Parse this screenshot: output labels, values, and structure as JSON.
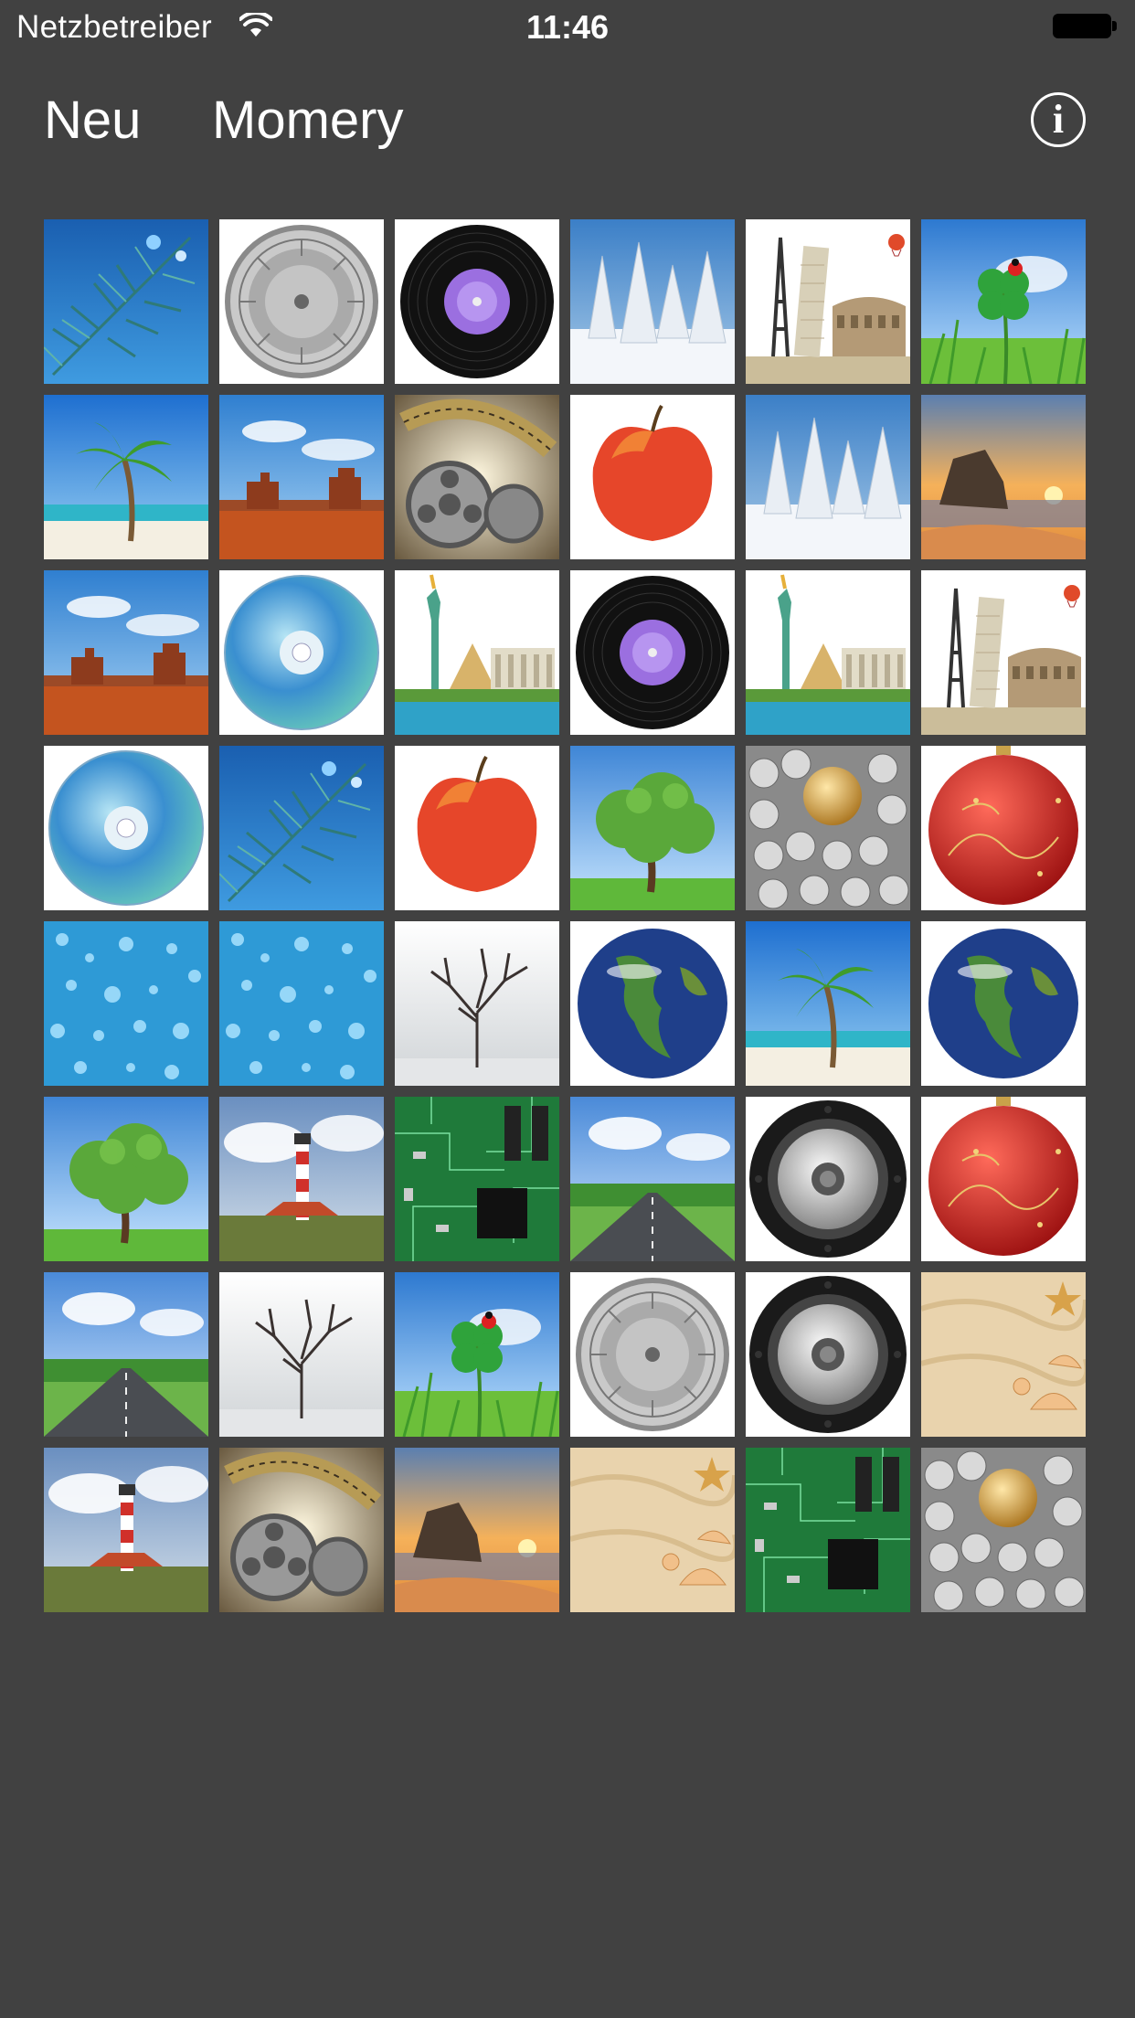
{
  "status_bar": {
    "carrier": "Netzbetreiber",
    "time": "11:46",
    "wifi_icon": "wifi-icon",
    "battery_icon": "battery-icon"
  },
  "nav": {
    "new_label": "Neu",
    "title": "Momery",
    "info_icon": "info-icon",
    "info_glyph": "i"
  },
  "colors": {
    "background": "#414141",
    "text": "#ffffff"
  },
  "cards": [
    [
      "pine-branch",
      "zodiac-coin",
      "vinyl-record",
      "snowy-trees",
      "world-landmarks",
      "clover-ladybug"
    ],
    [
      "palm-beach",
      "desert-monument",
      "film-reel",
      "red-apple",
      "snowy-trees",
      "sunset-coast"
    ],
    [
      "desert-monument",
      "compact-disc",
      "liberty-landmarks",
      "vinyl-record",
      "liberty-landmarks",
      "world-landmarks"
    ],
    [
      "compact-disc",
      "pine-branch",
      "red-apple",
      "green-tree",
      "silver-golden-spheres",
      "red-christmas-ornament"
    ],
    [
      "water-drops",
      "water-drops",
      "bare-winter-tree",
      "earth-globe",
      "palm-beach",
      "earth-globe"
    ],
    [
      "green-tree",
      "lighthouse",
      "circuit-board",
      "country-road",
      "speaker",
      "red-christmas-ornament"
    ],
    [
      "country-road",
      "bare-winter-tree",
      "clover-ladybug",
      "zodiac-coin",
      "speaker",
      "sand-shells"
    ],
    [
      "lighthouse",
      "film-reel",
      "sunset-coast",
      "sand-shells",
      "circuit-board",
      "silver-golden-spheres"
    ]
  ]
}
